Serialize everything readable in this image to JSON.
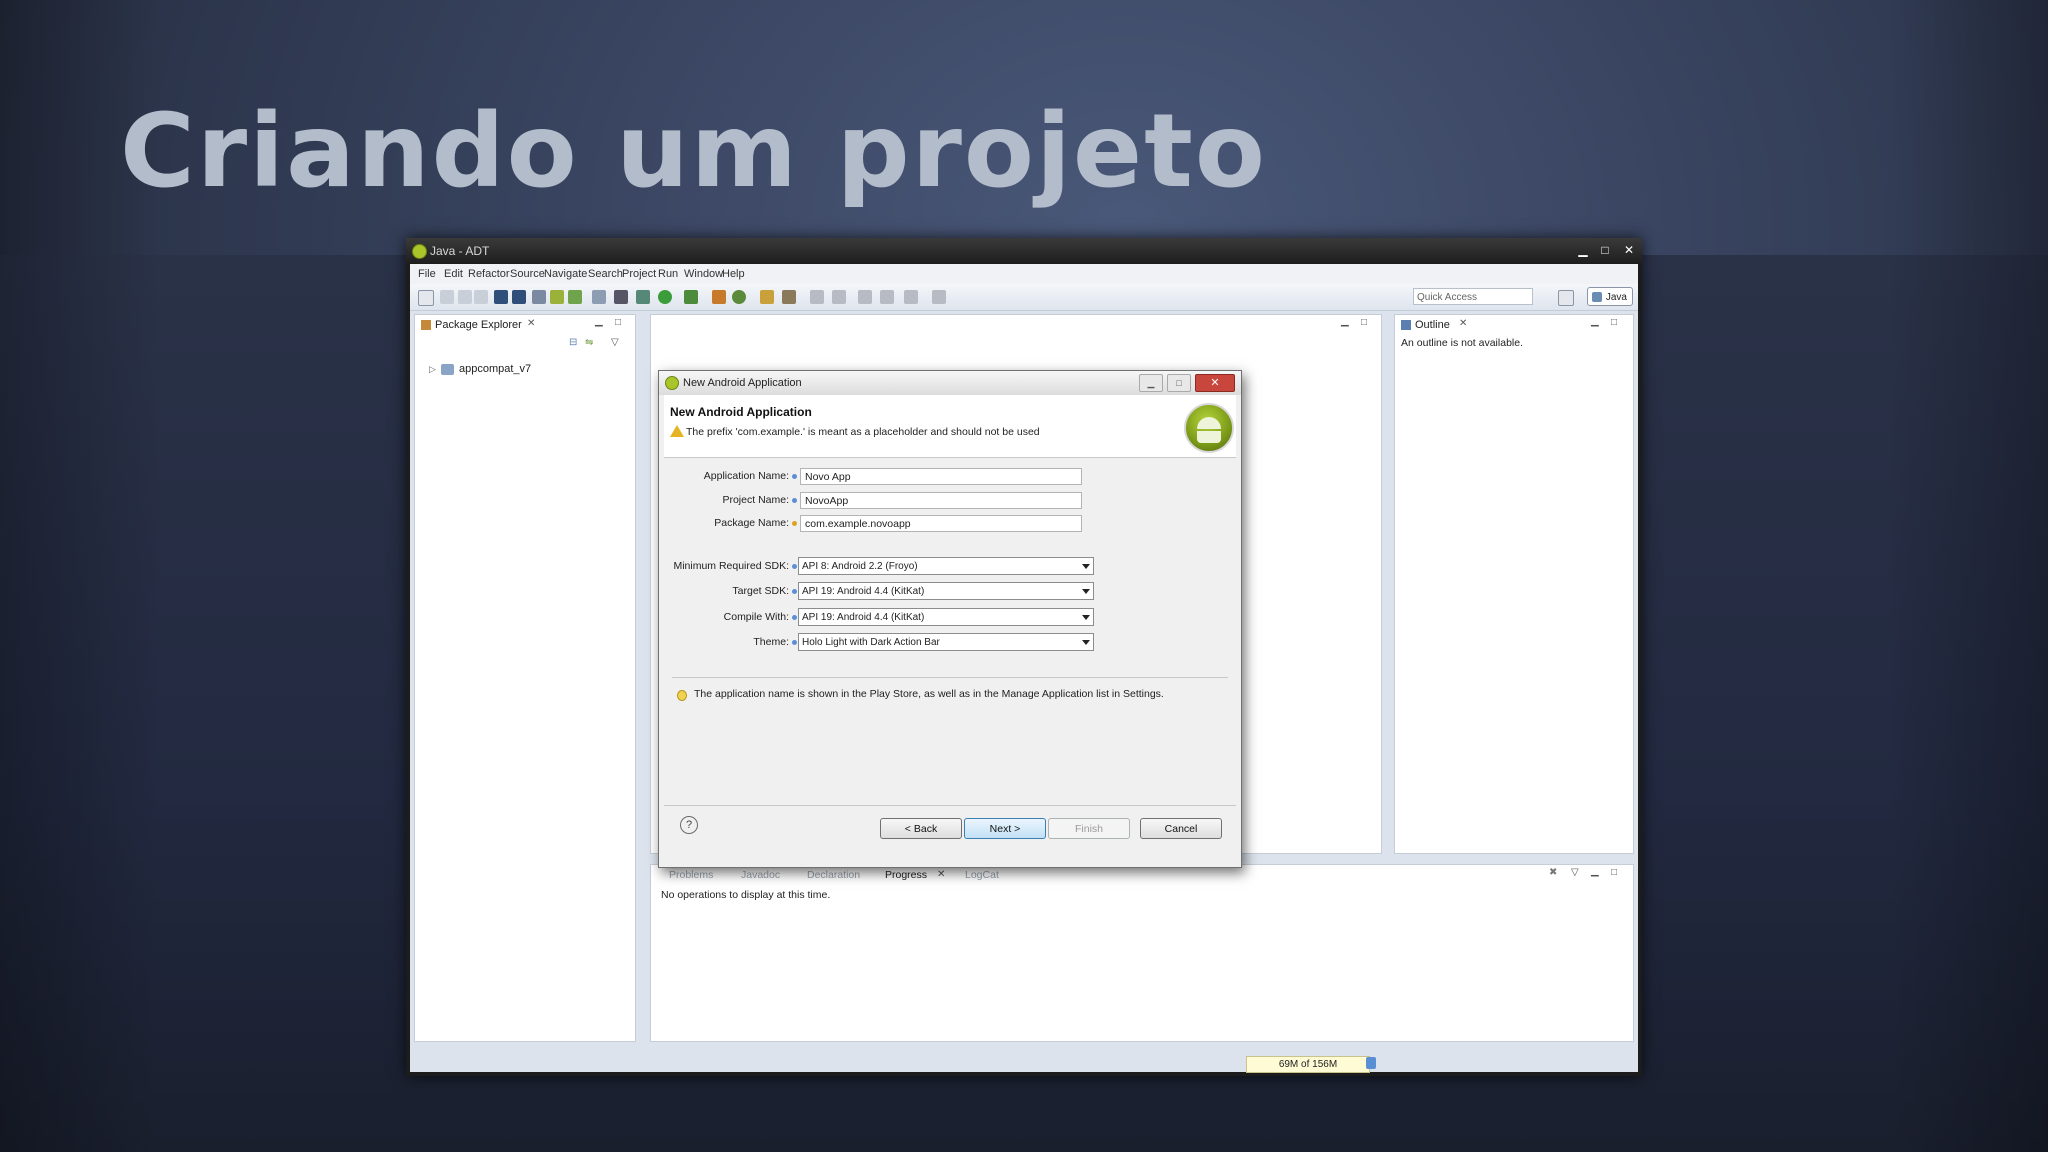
{
  "slide": {
    "title": "Criando um projeto"
  },
  "window": {
    "title": "Java - ADT",
    "minimize": "▁",
    "maximize": "□",
    "close": "✕"
  },
  "menu": [
    "File",
    "Edit",
    "Refactor",
    "Source",
    "Navigate",
    "Search",
    "Project",
    "Run",
    "Window",
    "Help"
  ],
  "toolbar": {
    "quick_access_placeholder": "Quick Access",
    "perspective": "Java"
  },
  "package_explorer": {
    "tab": "Package Explorer",
    "tree": [
      {
        "label": "appcompat_v7"
      }
    ]
  },
  "outline": {
    "tab": "Outline",
    "message": "An outline is not available."
  },
  "bottom_panel": {
    "tabs": [
      "Problems",
      "Javadoc",
      "Declaration",
      "Progress",
      "LogCat"
    ],
    "active_tab": "Progress",
    "message": "No operations to display at this time."
  },
  "dialog": {
    "window_title": "New Android Application",
    "heading": "New Android Application",
    "warning": "The prefix 'com.example.' is meant as a placeholder and should not be used",
    "fields": {
      "app_name": {
        "label": "Application Name:",
        "value": "Novo App"
      },
      "project_name": {
        "label": "Project Name:",
        "value": "NovoApp"
      },
      "package_name": {
        "label": "Package Name:",
        "value": "com.example.novoapp"
      }
    },
    "selects": {
      "min_sdk": {
        "label": "Minimum Required SDK:",
        "value": "API 8: Android 2.2 (Froyo)"
      },
      "target_sdk": {
        "label": "Target SDK:",
        "value": "API 19: Android 4.4 (KitKat)"
      },
      "compile_with": {
        "label": "Compile With:",
        "value": "API 19: Android 4.4 (KitKat)"
      },
      "theme": {
        "label": "Theme:",
        "value": "Holo Light with Dark Action Bar"
      }
    },
    "hint": "The application name is shown in the Play Store, as well as in the Manage Application list in Settings.",
    "buttons": {
      "back": "< Back",
      "next": "Next >",
      "finish": "Finish",
      "cancel": "Cancel",
      "help": "?"
    }
  },
  "status": {
    "memory": "69M of 156M"
  }
}
